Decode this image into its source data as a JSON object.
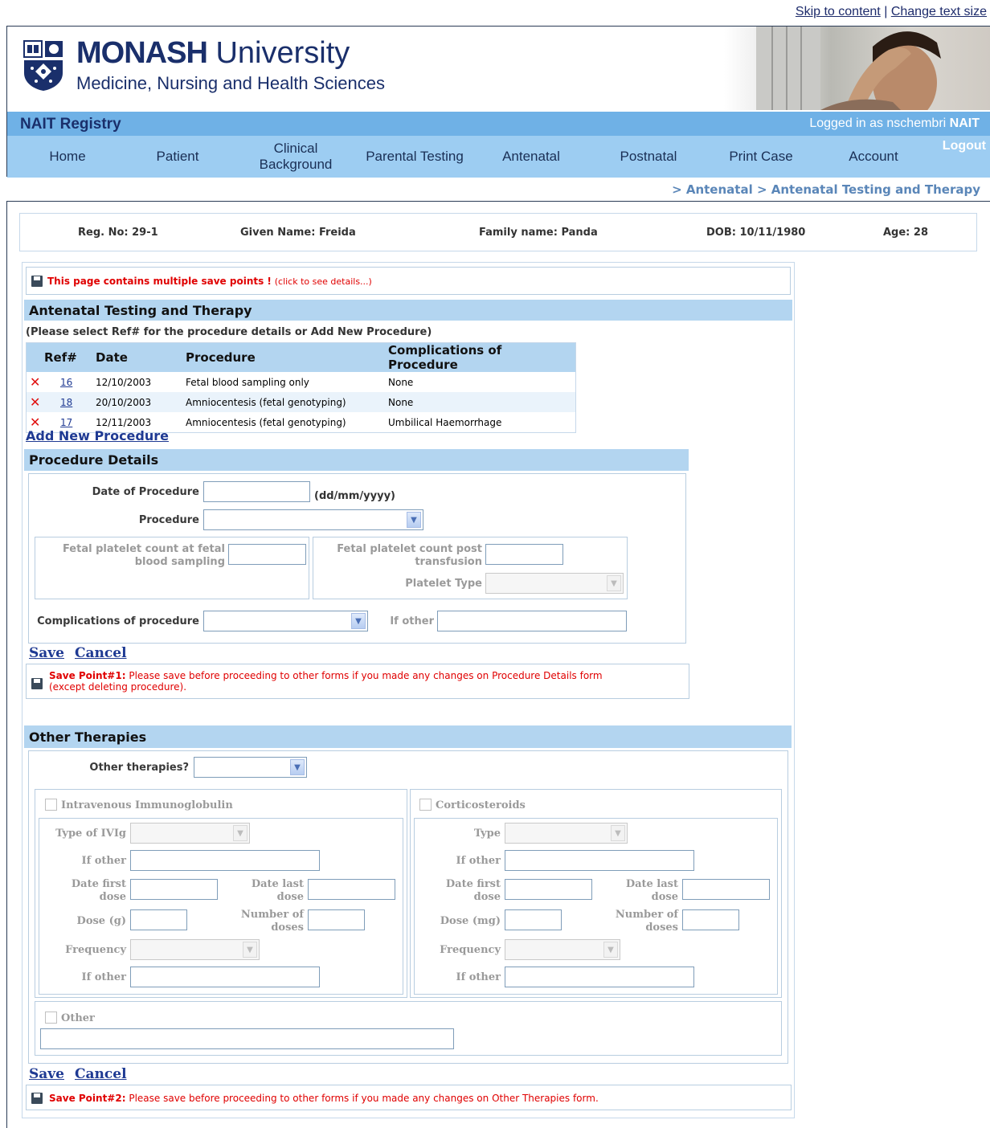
{
  "top_links": {
    "skip": "Skip to content",
    "separator": "|",
    "text_size": "Change text size"
  },
  "header": {
    "logo_title_bold": "MONASH",
    "logo_title_rest": " University",
    "logo_subtitle": "Medicine, Nursing and Health Sciences",
    "app_title": "NAIT Registry",
    "logged_in_prefix": "Logged in as nschembri",
    "logged_in_app": "NAIT",
    "logout": "Logout"
  },
  "nav": [
    "Home",
    "Patient",
    "Clinical\nBackground",
    "Parental Testing",
    "Antenatal",
    "Postnatal",
    "Print Case",
    "Account"
  ],
  "breadcrumb": "> Antenatal > Antenatal Testing and Therapy",
  "patient": {
    "reg_no": "Reg. No: 29-1",
    "given_name": "Given Name: Freida",
    "family_name": "Family name: Panda",
    "dob": "DOB: 10/11/1980",
    "age": "Age: 28"
  },
  "save_points_notice": {
    "bold": "This page contains multiple save points !",
    "detail": "(click to see details...)"
  },
  "antenatal": {
    "title": "Antenatal Testing and Therapy",
    "instruction": "(Please select Ref# for the procedure details or Add New Procedure)",
    "columns": [
      "Ref#",
      "Date",
      "Procedure",
      "Complications of Procedure"
    ],
    "rows": [
      {
        "ref": "16",
        "date": "12/10/2003",
        "procedure": "Fetal blood sampling only",
        "complication": "None"
      },
      {
        "ref": "18",
        "date": "20/10/2003",
        "procedure": "Amniocentesis (fetal genotyping)",
        "complication": "None"
      },
      {
        "ref": "17",
        "date": "12/11/2003",
        "procedure": "Amniocentesis (fetal genotyping)",
        "complication": "Umbilical Haemorrhage"
      }
    ],
    "add_new": "Add New Procedure"
  },
  "procedure_details": {
    "title": "Procedure Details",
    "date_label": "Date of Procedure",
    "date_value": "",
    "date_format": "(dd/mm/yyyy)",
    "procedure_label": "Procedure",
    "procedure_value": "",
    "fetal_count_label": "Fetal platelet count at fetal blood sampling",
    "post_transfusion_label": "Fetal platelet count post transfusion",
    "platelet_type_label": "Platelet Type",
    "complications_label": "Complications of procedure",
    "if_other_label": "If other",
    "save": "Save",
    "cancel": "Cancel",
    "save_point_bold": "Save Point#1:",
    "save_point_text": "Please save before proceeding to other forms if you made any changes on Procedure Details form",
    "save_point_text2": "(except deleting procedure)."
  },
  "other_therapies": {
    "title": "Other Therapies",
    "question": "Other therapies?",
    "ivig": {
      "heading": "Intravenous Immunoglobulin",
      "type_label": "Type of IVIg",
      "if_other": "If other",
      "date_first": "Date first dose",
      "date_last": "Date last dose",
      "dose": "Dose (g)",
      "num_doses": "Number of doses",
      "frequency": "Frequency",
      "if_other2": "If other"
    },
    "cortico": {
      "heading": "Corticosteroids",
      "type_label": "Type",
      "if_other": "If other",
      "date_first": "Date first dose",
      "date_last": "Date last dose",
      "dose": "Dose (mg)",
      "num_doses": "Number of doses",
      "frequency": "Frequency",
      "if_other2": "If other"
    },
    "other_heading": "Other",
    "save": "Save",
    "cancel": "Cancel",
    "save_point_bold": "Save Point#2:",
    "save_point_text": "Please save before proceeding to other forms if you made any changes on Other Therapies form."
  },
  "colors": {
    "nav_bar": "#9dcdf2",
    "title_bar": "#6fb1e6",
    "section_head": "#b3d5f0",
    "brand": "#1a2f6b",
    "alert": "#e00000"
  }
}
